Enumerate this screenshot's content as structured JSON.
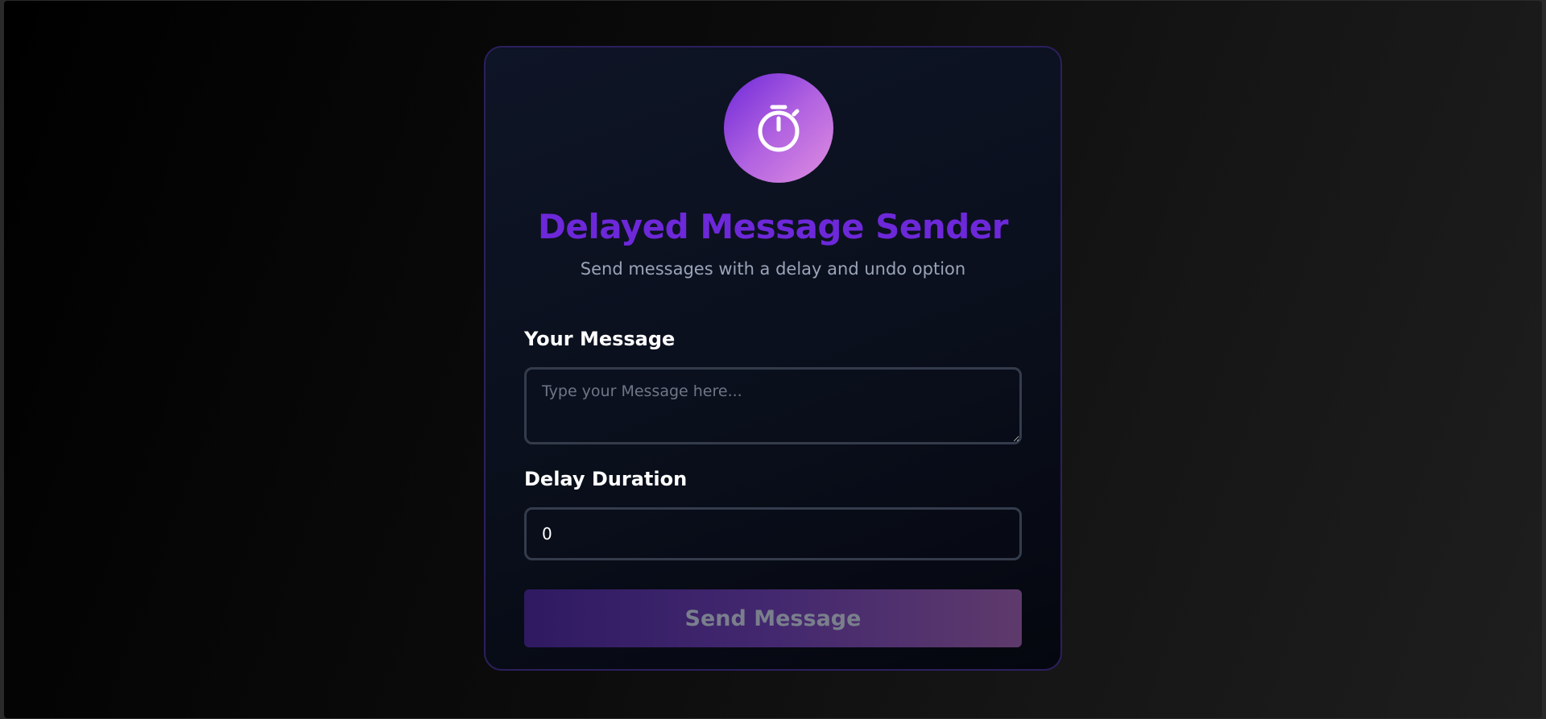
{
  "app": {
    "logo_icon": "stopwatch-icon",
    "title": "Delayed Message Sender",
    "subtitle": "Send messages with a delay and undo option"
  },
  "form": {
    "message_label": "Your Message",
    "message_placeholder": "Type your Message here...",
    "message_value": "",
    "delay_label": "Delay Duration",
    "delay_value": "0",
    "send_label": "Send Message",
    "send_disabled": true
  },
  "colors": {
    "accent": "#6d28d9",
    "logo_gradient_start": "#6d28d9",
    "logo_gradient_end": "#e08ee0",
    "subtitle": "#9aa4b8",
    "input_border": "#343c4c"
  }
}
